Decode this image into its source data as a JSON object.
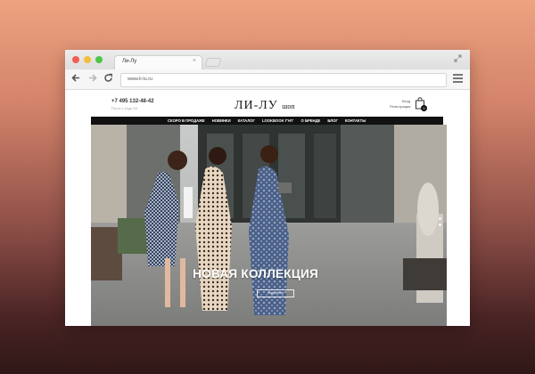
{
  "browser": {
    "tab_title": "Ли-Лу",
    "tab_close": "×",
    "url": "www.li-lu.ru"
  },
  "header": {
    "phone": "+7 495 132-48-42",
    "hours": "Пн-пт с 11до 19",
    "logo_main": "ЛИ-ЛУ",
    "logo_sub": "шоп",
    "login": "Вход",
    "register": "Регистрация",
    "cart_count": "0"
  },
  "nav": {
    "items": [
      "СКОРО В ПРОДАЖЕ",
      "НОВИНКИ",
      "КАТАЛОГ",
      "LOOKBOOK Г'Н'Г",
      "О БРЕНДЕ",
      "БЛОГ",
      "КОНТАКТЫ"
    ]
  },
  "hero": {
    "title": "НОВАЯ КОЛЛЕКЦИЯ",
    "button": "Подробнее"
  },
  "icons": {
    "back": "arrow-left-icon",
    "forward": "arrow-right-icon",
    "reload": "reload-icon",
    "menu": "hamburger-menu-icon",
    "cart": "shopping-bag-icon",
    "search": "search-icon"
  }
}
